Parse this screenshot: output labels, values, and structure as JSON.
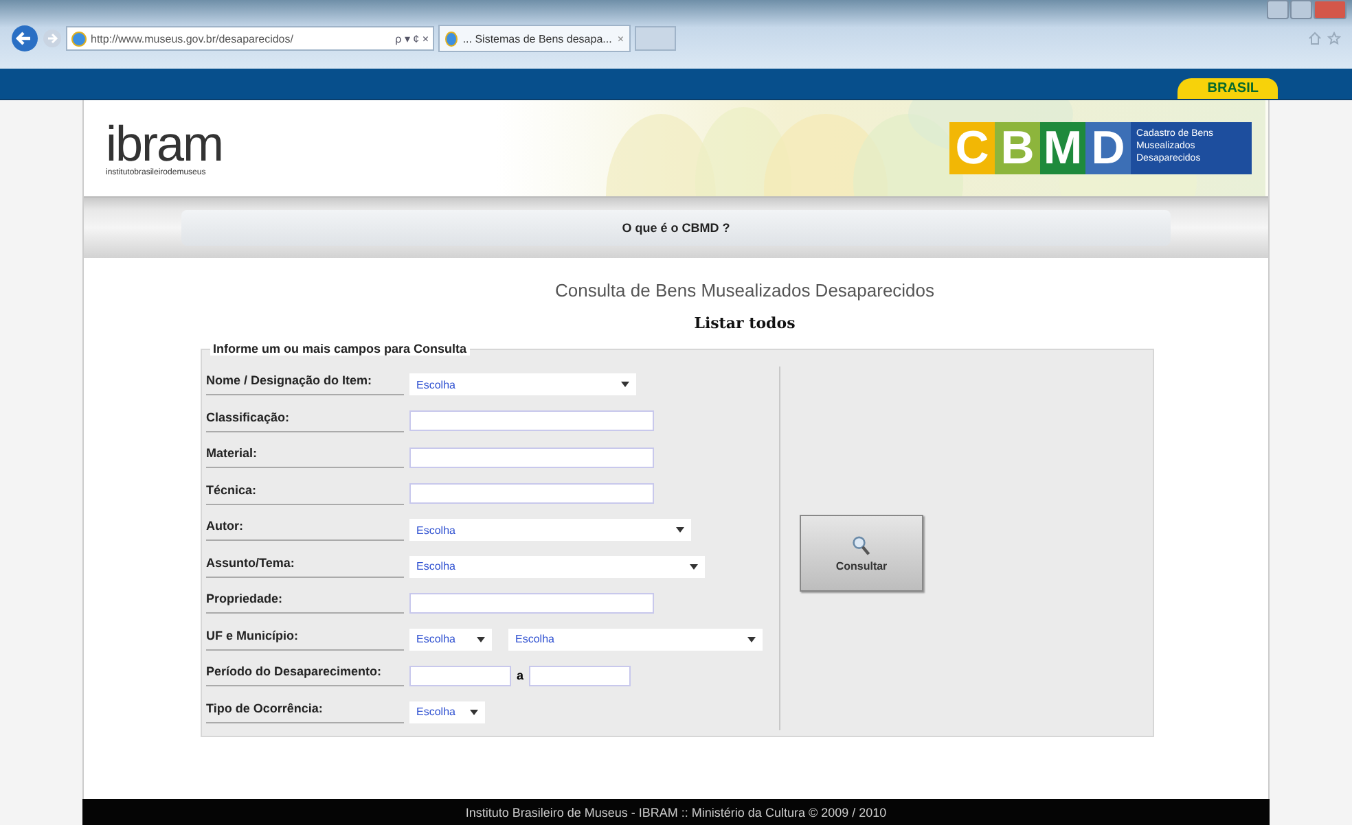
{
  "browser": {
    "address": "http://www.museus.gov.br/desaparecidos/",
    "address_icons": "ρ ▾ ¢ ×",
    "tab": "... Sistemas de Bens desapa...",
    "tab_close": "×"
  },
  "gov_bar": {
    "label": "BRASIL"
  },
  "header": {
    "logo": "ibram",
    "logo_subtitle": "institutobrasileirodemuseus",
    "cbmd_letters": [
      "C",
      "B",
      "M",
      "D"
    ],
    "cbmd_caption": "Cadastro de Bens Musealizados Desaparecidos"
  },
  "nav": {
    "link": "O que é o CBMD ?"
  },
  "title": "Consulta de Bens Musealizados Desaparecidos",
  "list_all": "Listar todos",
  "form": {
    "legend": "Informe um ou mais campos para Consulta",
    "fields": [
      {
        "label": "Nome / Designação do Item:",
        "kind": "select",
        "values": [
          "Escolha"
        ]
      },
      {
        "label": "Classificação:",
        "kind": "text"
      },
      {
        "label": "Material:",
        "kind": "text"
      },
      {
        "label": "Técnica:",
        "kind": "text"
      },
      {
        "label": "Autor:",
        "kind": "select",
        "values": [
          "Escolha"
        ]
      },
      {
        "label": "Assunto/Tema:",
        "kind": "select",
        "values": [
          "Escolha"
        ]
      },
      {
        "label": "Propriedade:",
        "kind": "text"
      },
      {
        "label": "UF e Município:",
        "kind": "select-pair",
        "values": [
          "Escolha",
          "Escolha"
        ]
      },
      {
        "label": "Período do Desaparecimento:",
        "kind": "range",
        "joiner": "a"
      },
      {
        "label": "Tipo de Ocorrência:",
        "kind": "select-short",
        "values": [
          "Escolha"
        ]
      }
    ],
    "submit": "Consultar"
  },
  "footer": "Instituto Brasileiro de Museus - IBRAM :: Ministério da Cultura © 2009 / 2010"
}
